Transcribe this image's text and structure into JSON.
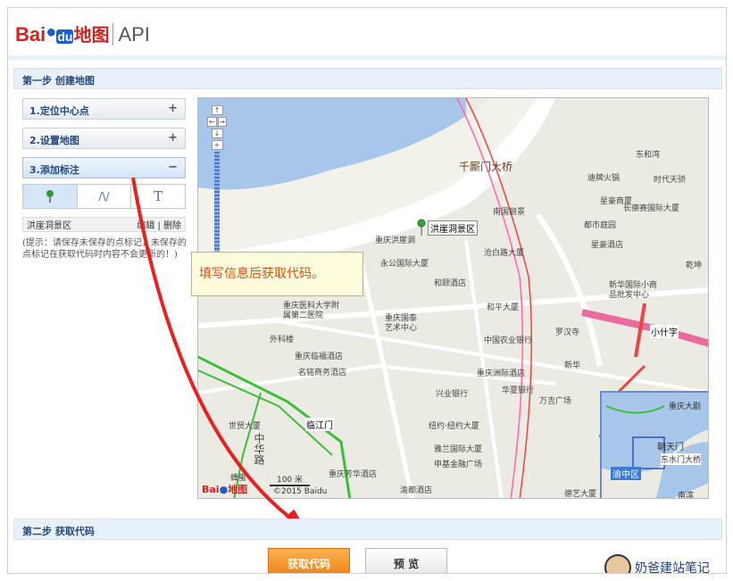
{
  "header": {
    "logo_bai": "Bai",
    "logo_paw": "du",
    "logo_ditu": "地图",
    "logo_api": "API"
  },
  "step1": {
    "title": "第一步 创建地图"
  },
  "accordion": [
    {
      "label": "1.定位中心点",
      "sign": "+"
    },
    {
      "label": "2.设置地图",
      "sign": "+"
    },
    {
      "label": "3.添加标注",
      "sign": "−"
    }
  ],
  "tools": {
    "line": "/\\/",
    "text": "T"
  },
  "marker": {
    "name": "洪崖洞景区",
    "edit": "编辑",
    "sep": "|",
    "delete": "删除"
  },
  "hint": "(提示：请保存未保存的点标记，未保存的点标记在获取代码时内容不会更新的！)",
  "callout": "填写信息后获取代码。",
  "step2": {
    "title": "第二步 获取代码"
  },
  "buttons": {
    "get_code": "获取代码",
    "preview": "预 览"
  },
  "watermark": "奶爸建站笔记",
  "map": {
    "zoom_in": "+",
    "zoom_out": "−",
    "pan_up": "↑",
    "pan_left": "←",
    "pan_right": "→",
    "pan_down": "↓",
    "marker_label": "洪崖洞景区",
    "scale_label": "100 米",
    "copyright": "©2015 Baidu",
    "overview_title": "重庆大剧",
    "overview_labels": [
      "朝天门",
      "东水门大桥",
      "渝中区",
      "南滨"
    ],
    "labels": [
      {
        "text": "千厮门大桥",
        "cls": "big"
      },
      {
        "text": "南国丽景",
        "cls": ""
      },
      {
        "text": "重庆洪崖洞",
        "cls": ""
      },
      {
        "text": "永公国际大厦",
        "cls": ""
      },
      {
        "text": "沧白路大厦",
        "cls": ""
      },
      {
        "text": "和颐酒店",
        "cls": ""
      },
      {
        "text": "和平大厦",
        "cls": ""
      },
      {
        "text": "重庆医科大学附属第二医院",
        "cls": ""
      },
      {
        "text": "重庆国泰艺术中心",
        "cls": ""
      },
      {
        "text": "外科楼",
        "cls": ""
      },
      {
        "text": "重庆临福酒店",
        "cls": ""
      },
      {
        "text": "名铭商务酒店",
        "cls": ""
      },
      {
        "text": "中国农业银行",
        "cls": ""
      },
      {
        "text": "重庆洲际酒店",
        "cls": ""
      },
      {
        "text": "兴业银行",
        "cls": ""
      },
      {
        "text": "华夏银行",
        "cls": ""
      },
      {
        "text": "万吉广场",
        "cls": ""
      },
      {
        "text": "临江门",
        "cls": "station"
      },
      {
        "text": "世贸大厦",
        "cls": ""
      },
      {
        "text": "纽约·纽约大厦",
        "cls": ""
      },
      {
        "text": "雅兰国际大厦",
        "cls": ""
      },
      {
        "text": "申基金融广场",
        "cls": ""
      },
      {
        "text": "重庆芳华酒店",
        "cls": ""
      },
      {
        "text": "渝都酒店",
        "cls": ""
      },
      {
        "text": "德艺大厦",
        "cls": ""
      },
      {
        "text": "东和湾",
        "cls": ""
      },
      {
        "text": "时代天骄",
        "cls": ""
      },
      {
        "text": "星豪酒店",
        "cls": ""
      },
      {
        "text": "迪牌火锅",
        "cls": ""
      },
      {
        "text": "都市庭园",
        "cls": ""
      },
      {
        "text": "新华国际小商品批发中心",
        "cls": ""
      },
      {
        "text": "小什字",
        "cls": "station"
      },
      {
        "text": "罗汉寺",
        "cls": ""
      },
      {
        "text": "新华",
        "cls": ""
      },
      {
        "text": "星豪商厦",
        "cls": ""
      },
      {
        "text": "长德赛国际大厦",
        "cls": ""
      },
      {
        "text": "乾坤",
        "cls": ""
      },
      {
        "text": "中华路",
        "cls": "road"
      },
      {
        "text": "蜂蜜",
        "cls": ""
      }
    ]
  }
}
